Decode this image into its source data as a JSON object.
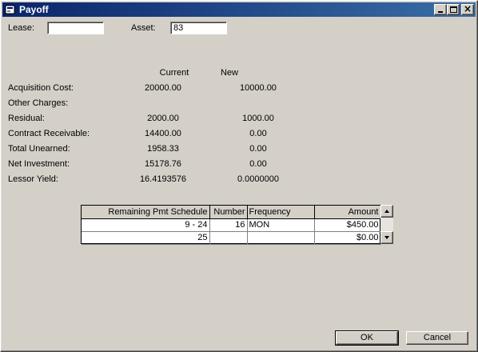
{
  "window": {
    "title": "Payoff",
    "icon": "payoff-app-icon"
  },
  "header": {
    "lease_label": "Lease:",
    "lease_value": "",
    "asset_label": "Asset:",
    "asset_value": "83"
  },
  "columns": {
    "current": "Current",
    "new": "New"
  },
  "rows": [
    {
      "label": "Acquisition Cost:",
      "current": "20000.00",
      "new": "10000.00"
    },
    {
      "label": "Other Charges:",
      "current": "",
      "new": ""
    },
    {
      "label": "Residual:",
      "current": "2000.00",
      "new": "1000.00"
    },
    {
      "label": "Contract Receivable:",
      "current": "14400.00",
      "new": "0.00"
    },
    {
      "label": "Total Unearned:",
      "current": "1958.33",
      "new": "0.00"
    },
    {
      "label": "Net Investment:",
      "current": "15178.76",
      "new": "0.00"
    },
    {
      "label": "Lessor Yield:",
      "current": "16.4193576",
      "new": "0.0000000"
    }
  ],
  "schedule": {
    "headers": [
      "Remaining Pmt Schedule",
      "Number",
      "Frequency",
      "Amount"
    ],
    "rows": [
      {
        "range": "9 -  24",
        "number": "16",
        "frequency": "MON",
        "amount": "$450.00"
      },
      {
        "range": "25",
        "number": "",
        "frequency": "",
        "amount": "$0.00"
      }
    ]
  },
  "buttons": {
    "ok": "OK",
    "cancel": "Cancel"
  },
  "colors": {
    "titlebar_start": "#0a246a",
    "titlebar_end": "#3a6ea5",
    "face": "#d4d0c8"
  }
}
